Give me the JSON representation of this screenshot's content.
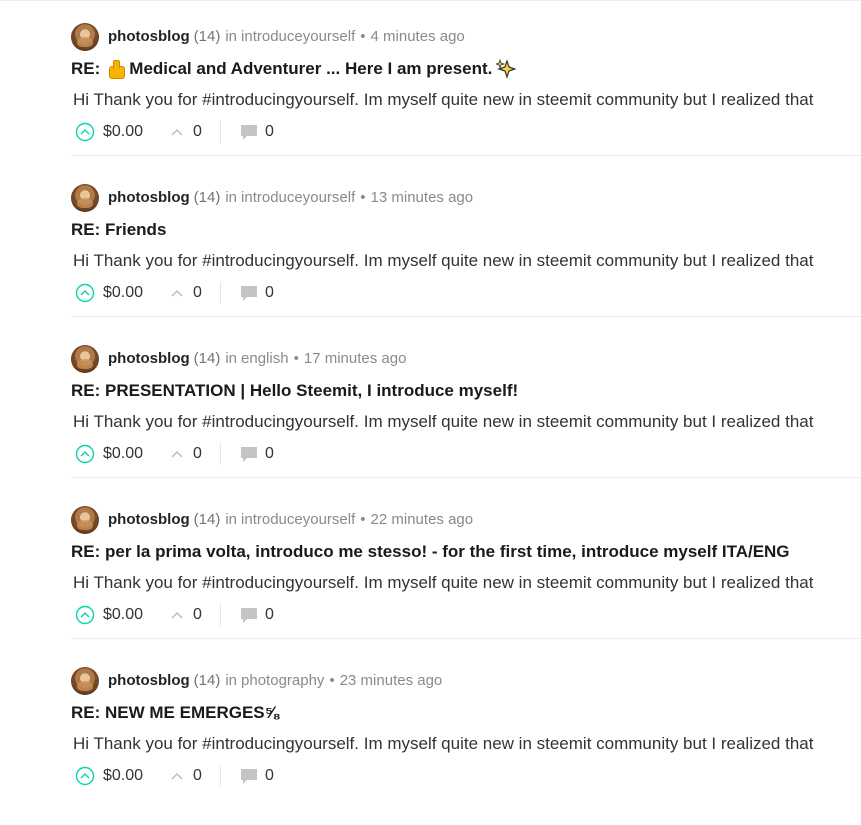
{
  "posts": [
    {
      "author": "photosblog",
      "reputation": "(14)",
      "in_label": "in",
      "community": "introduceyourself",
      "bullet": "•",
      "time": "4 minutes ago",
      "title": "RE: ",
      "title_after_emoji": "Medical and Adventurer ... Here I am present.",
      "has_thumb_emoji": true,
      "has_sparkle_emoji": true,
      "body": "Hi Thank you for #introducingyourself. Im myself quite new in steemit community but I realized that",
      "payout": "$0.00",
      "votes": "0",
      "comments": "0"
    },
    {
      "author": "photosblog",
      "reputation": "(14)",
      "in_label": "in",
      "community": "introduceyourself",
      "bullet": "•",
      "time": "13 minutes ago",
      "title": "RE: Friends",
      "body": "Hi Thank you for #introducingyourself. Im myself quite new in steemit community but I realized that",
      "payout": "$0.00",
      "votes": "0",
      "comments": "0"
    },
    {
      "author": "photosblog",
      "reputation": "(14)",
      "in_label": "in",
      "community": "english",
      "bullet": "•",
      "time": "17 minutes ago",
      "title": "RE: PRESENTATION | Hello Steemit, I introduce myself!",
      "body": "Hi Thank you for #introducingyourself. Im myself quite new in steemit community but I realized that",
      "payout": "$0.00",
      "votes": "0",
      "comments": "0"
    },
    {
      "author": "photosblog",
      "reputation": "(14)",
      "in_label": "in",
      "community": "introduceyourself",
      "bullet": "•",
      "time": "22 minutes ago",
      "title": "RE: per la prima volta, introduco me stesso! - for the first time, introduce myself ITA/ENG",
      "body": "Hi Thank you for #introducingyourself. Im myself quite new in steemit community but I realized that",
      "payout": "$0.00",
      "votes": "0",
      "comments": "0"
    },
    {
      "author": "photosblog",
      "reputation": "(14)",
      "in_label": "in",
      "community": "photography",
      "bullet": "•",
      "time": "23 minutes ago",
      "title": "RE: NEW ME EMERGES⅝",
      "body": "Hi Thank you for #introducingyourself. Im myself quite new in steemit community but I realized that",
      "payout": "$0.00",
      "votes": "0",
      "comments": "0"
    }
  ],
  "colors": {
    "upvote_accent": "#06d6a9",
    "muted_text": "#8a8a8a",
    "divider": "#eeeeee"
  },
  "icons": {
    "upvote": "upvote-circle-icon",
    "votes": "caret-up-icon",
    "comments": "comment-bubble-icon"
  }
}
